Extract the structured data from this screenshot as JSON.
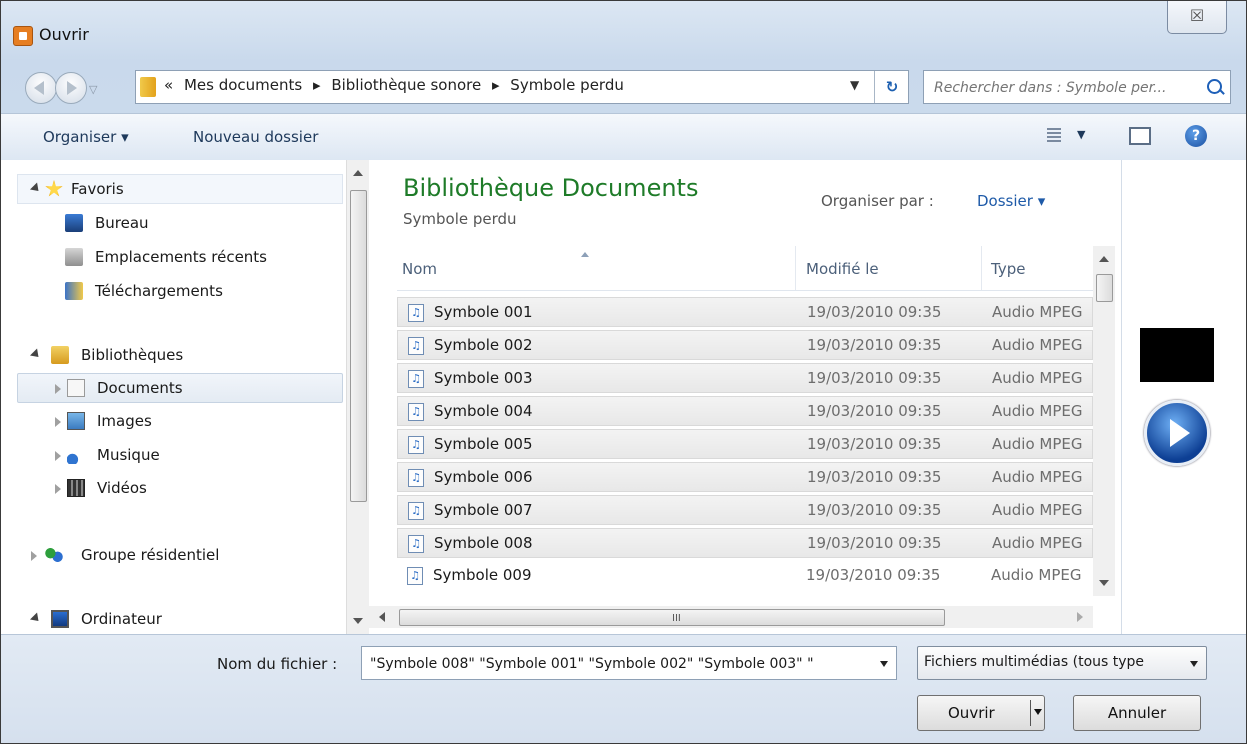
{
  "window": {
    "title": "Ouvrir",
    "close_label": "☒"
  },
  "address": {
    "crumbs": [
      "«",
      "Mes documents",
      "▸",
      "Bibliothèque sonore",
      "▸",
      "Symbole perdu"
    ],
    "search_placeholder": "Rechercher dans : Symbole per..."
  },
  "toolbar": {
    "organiser": "Organiser ▾",
    "nouveau_dossier": "Nouveau dossier",
    "help": "?"
  },
  "nav": {
    "favoris": "Favoris",
    "bureau": "Bureau",
    "recents": "Emplacements récents",
    "telechargements": "Téléchargements",
    "bibliotheques": "Bibliothèques",
    "documents": "Documents",
    "images": "Images",
    "musique": "Musique",
    "videos": "Vidéos",
    "groupe": "Groupe résidentiel",
    "ordinateur": "Ordinateur"
  },
  "content": {
    "title": "Bibliothèque Documents",
    "subtitle": "Symbole perdu",
    "arrange_label": "Organiser par :",
    "arrange_value": "Dossier ▾",
    "columns": {
      "name": "Nom",
      "modified": "Modifié le",
      "type": "Type"
    },
    "files": [
      {
        "name": "Symbole 001",
        "modified": "19/03/2010 09:35",
        "type": "Audio MPEG",
        "selected": true
      },
      {
        "name": "Symbole 002",
        "modified": "19/03/2010 09:35",
        "type": "Audio MPEG",
        "selected": true
      },
      {
        "name": "Symbole 003",
        "modified": "19/03/2010 09:35",
        "type": "Audio MPEG",
        "selected": true
      },
      {
        "name": "Symbole 004",
        "modified": "19/03/2010 09:35",
        "type": "Audio MPEG",
        "selected": true
      },
      {
        "name": "Symbole 005",
        "modified": "19/03/2010 09:35",
        "type": "Audio MPEG",
        "selected": true
      },
      {
        "name": "Symbole 006",
        "modified": "19/03/2010 09:35",
        "type": "Audio MPEG",
        "selected": true
      },
      {
        "name": "Symbole 007",
        "modified": "19/03/2010 09:35",
        "type": "Audio MPEG",
        "selected": true
      },
      {
        "name": "Symbole 008",
        "modified": "19/03/2010 09:35",
        "type": "Audio MPEG",
        "selected": true
      },
      {
        "name": "Symbole 009",
        "modified": "19/03/2010 09:35",
        "type": "Audio MPEG",
        "selected": false
      }
    ]
  },
  "scroll": {
    "grip": "III"
  },
  "footer": {
    "filename_label": "Nom du fichier :",
    "filename_value": "\"Symbole 008\" \"Symbole 001\" \"Symbole 002\" \"Symbole 003\" \"",
    "filter_value": "Fichiers multimédias (tous type",
    "open_button": "Ouvrir",
    "cancel_button": "Annuler"
  }
}
